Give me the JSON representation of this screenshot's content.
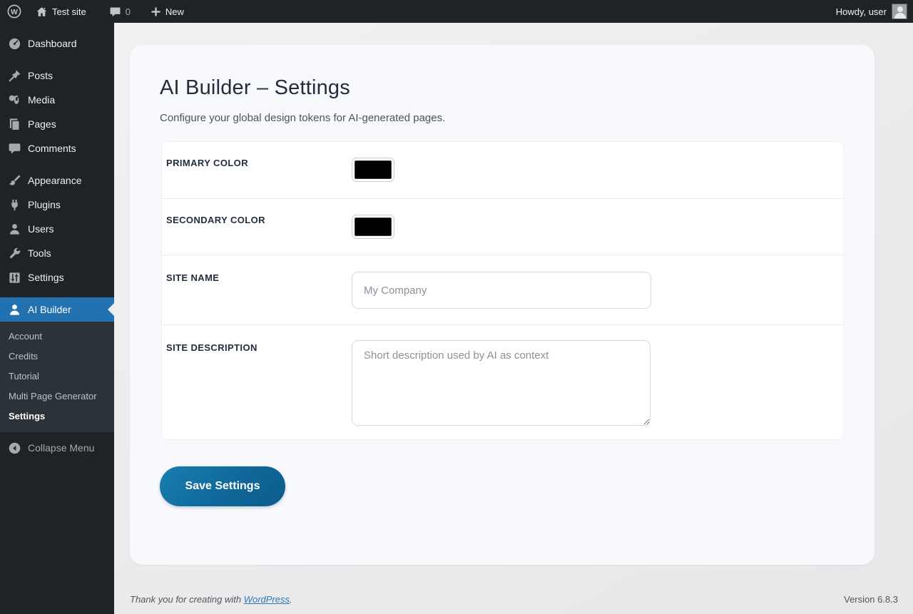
{
  "admin_bar": {
    "site_name": "Test site",
    "comment_count": "0",
    "new_label": "New",
    "howdy": "Howdy, user"
  },
  "sidebar": {
    "items": [
      {
        "label": "Dashboard",
        "icon": "dashboard-icon"
      },
      {
        "label": "Posts",
        "icon": "pushpin-icon"
      },
      {
        "label": "Media",
        "icon": "media-icon"
      },
      {
        "label": "Pages",
        "icon": "pages-icon"
      },
      {
        "label": "Comments",
        "icon": "comments-icon"
      },
      {
        "label": "Appearance",
        "icon": "appearance-icon"
      },
      {
        "label": "Plugins",
        "icon": "plugins-icon"
      },
      {
        "label": "Users",
        "icon": "users-icon"
      },
      {
        "label": "Tools",
        "icon": "tools-icon"
      },
      {
        "label": "Settings",
        "icon": "settings-icon"
      },
      {
        "label": "AI Builder",
        "icon": "ai-builder-icon",
        "active": true
      }
    ],
    "submenu": [
      {
        "label": "Account"
      },
      {
        "label": "Credits"
      },
      {
        "label": "Tutorial"
      },
      {
        "label": "Multi Page Generator"
      },
      {
        "label": "Settings",
        "active": true
      }
    ],
    "collapse_label": "Collapse Menu"
  },
  "main": {
    "title": "AI Builder – Settings",
    "subtitle": "Configure your global design tokens for AI-generated pages.",
    "fields": [
      {
        "label": "PRIMARY COLOR",
        "type": "color",
        "value": "#000000"
      },
      {
        "label": "SECONDARY COLOR",
        "type": "color",
        "value": "#000000"
      },
      {
        "label": "SITE NAME",
        "type": "text",
        "value": "",
        "placeholder": "My Company"
      },
      {
        "label": "SITE DESCRIPTION",
        "type": "textarea",
        "value": "",
        "placeholder": "Short description used by AI as context"
      }
    ],
    "save_button_label": "Save Settings"
  },
  "footer": {
    "thanks_prefix": "Thank you for creating with ",
    "wordpress_link": "WordPress",
    "thanks_suffix": ".",
    "version": "Version 6.8.3"
  },
  "colors": {
    "accent_blue": "#2271b1",
    "admin_dark": "#1d2327",
    "submenu_dark": "#2c3338",
    "save_button_gradient_start": "#1a7db1",
    "save_button_gradient_end": "#0b5c8b",
    "card_background": "#f8f9fc"
  }
}
